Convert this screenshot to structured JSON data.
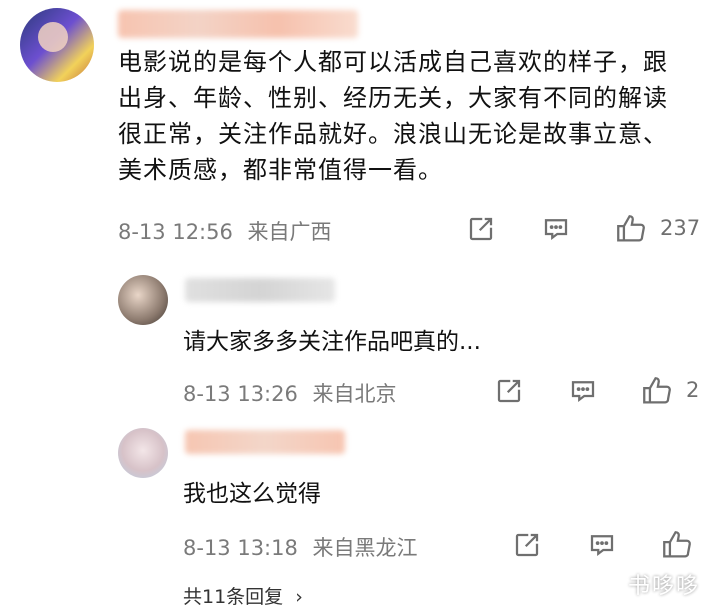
{
  "comment": {
    "text": "电影说的是每个人都可以活成自己喜欢的样子，跟出身、年龄、性别、经历无关，大家有不同的解读很正常，关注作品就好。浪浪山无论是故事立意、美术质感，都非常值得一看。",
    "lines": [
      "电影说的是每个人都可以活成自己喜欢的样子，跟",
      "出身、年龄、性别、经历无关，大家有不同的解读",
      "很正常，关注作品就好。浪浪山无论是故事立意、",
      "美术质感，都非常值得一看。"
    ],
    "time": "8-13 12:56",
    "location": "来自广西",
    "likes": "237",
    "icons": {
      "share": "share-icon",
      "comment": "comment-icon",
      "like": "thumbs-up-icon"
    }
  },
  "replies": [
    {
      "text": "请大家多多关注作品吧真的...",
      "time": "8-13 13:26",
      "location": "来自北京",
      "likes": "2"
    },
    {
      "text": "我也这么觉得",
      "time": "8-13 13:18",
      "location": "来自黑龙江",
      "likes": ""
    }
  ],
  "more_replies": "共11条回复",
  "watermark": "书哆哆",
  "colors": {
    "blur_name": "#f6c7b4",
    "blur_name_gray": "#d9d9d9",
    "meta": "#7a7a7a",
    "icon": "#6f6f6f"
  }
}
